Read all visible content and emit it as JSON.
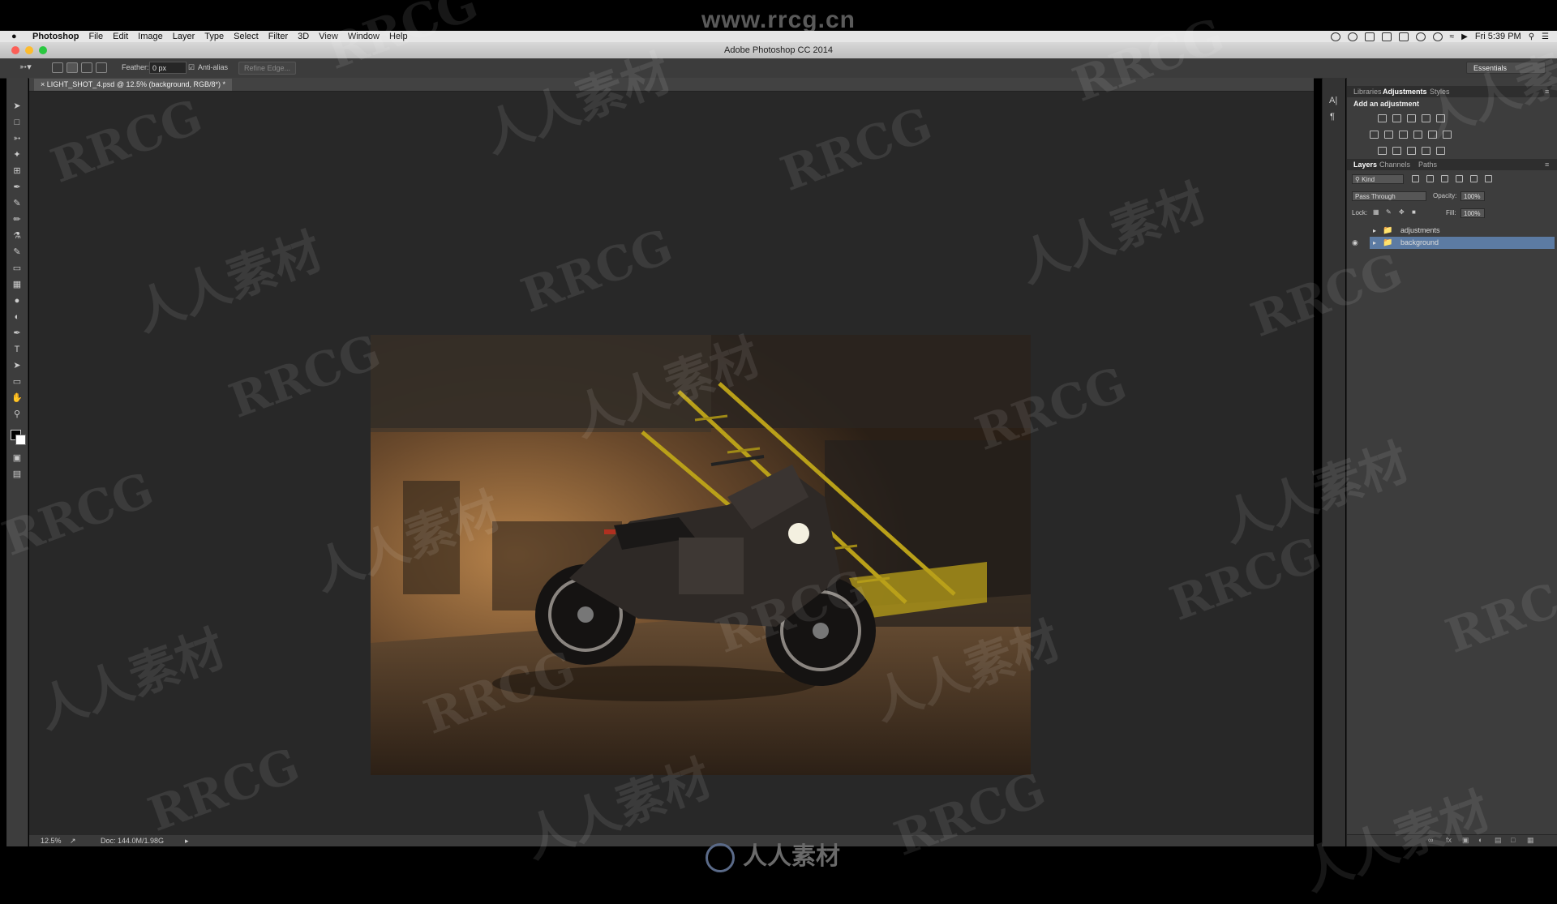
{
  "watermark": {
    "url": "www.rrcg.cn",
    "latin": "RRCG",
    "cjk": "人人素材"
  },
  "menubar": {
    "app": "Photoshop",
    "items": [
      "File",
      "Edit",
      "Image",
      "Layer",
      "Type",
      "Select",
      "Filter",
      "3D",
      "View",
      "Window",
      "Help"
    ],
    "clock": "Fri 5:39 PM"
  },
  "window": {
    "title": "Adobe Photoshop CC 2014"
  },
  "options": {
    "feather_label": "Feather:",
    "feather_value": "0 px",
    "antialias_label": "Anti-alias",
    "antialias_checked": true,
    "refine_edge": "Refine Edge...",
    "workspace": "Essentials"
  },
  "document": {
    "tab": "LIGHT_SHOT_4.psd @ 12.5% (background, RGB/8*) *",
    "zoom": "12.5%",
    "doc_size": "Doc: 144.0M/1.98G"
  },
  "tools": [
    "move-tool-icon",
    "marquee-tool-icon",
    "lasso-tool-icon",
    "quick-select-tool-icon",
    "crop-tool-icon",
    "eyedropper-tool-icon",
    "healing-brush-icon",
    "brush-tool-icon",
    "clone-stamp-icon",
    "history-brush-icon",
    "eraser-tool-icon",
    "gradient-tool-icon",
    "blur-tool-icon",
    "dodge-tool-icon",
    "pen-tool-icon",
    "type-tool-icon",
    "path-select-icon",
    "shape-tool-icon",
    "hand-tool-icon",
    "zoom-tool-icon"
  ],
  "panels": {
    "top_tabs": [
      "Libraries",
      "Adjustments",
      "Styles"
    ],
    "active_top_tab": "Adjustments",
    "adjustments_title": "Add an adjustment",
    "layer_tabs": [
      "Layers",
      "Channels",
      "Paths"
    ],
    "active_layer_tab": "Layers",
    "filter_kind": "Kind",
    "blend_mode": "Pass Through",
    "opacity_label": "Opacity:",
    "opacity_value": "100%",
    "lock_label": "Lock:",
    "fill_label": "Fill:",
    "fill_value": "100%",
    "layers": [
      {
        "name": "adjustments",
        "type": "group",
        "visible": false,
        "selected": false
      },
      {
        "name": "background",
        "type": "group",
        "visible": true,
        "selected": true
      }
    ]
  },
  "colors": {
    "accent_selection": "#5c7ba3",
    "canvas_bg": "#282828",
    "stair_yellow": "#b9a019"
  }
}
